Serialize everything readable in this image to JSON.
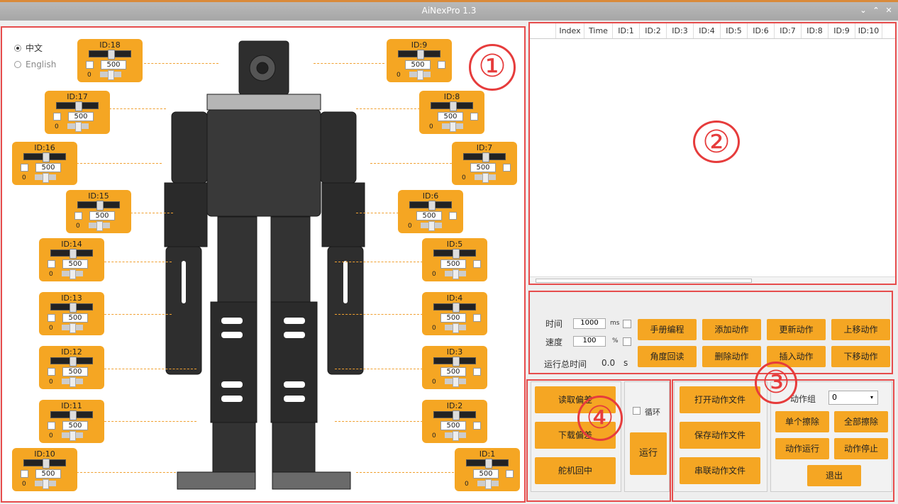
{
  "window": {
    "title": "AiNexPro 1.3"
  },
  "language": {
    "options": [
      "中文",
      "English"
    ],
    "selected": "中文"
  },
  "servos": [
    {
      "id": "ID:18",
      "value": "500",
      "min": "0"
    },
    {
      "id": "ID:17",
      "value": "500",
      "min": "0"
    },
    {
      "id": "ID:16",
      "value": "500",
      "min": "0"
    },
    {
      "id": "ID:15",
      "value": "500",
      "min": "0"
    },
    {
      "id": "ID:14",
      "value": "500",
      "min": "0"
    },
    {
      "id": "ID:13",
      "value": "500",
      "min": "0"
    },
    {
      "id": "ID:12",
      "value": "500",
      "min": "0"
    },
    {
      "id": "ID:11",
      "value": "500",
      "min": "0"
    },
    {
      "id": "ID:10",
      "value": "500",
      "min": "0"
    },
    {
      "id": "ID:9",
      "value": "500",
      "min": "0"
    },
    {
      "id": "ID:8",
      "value": "500",
      "min": "0"
    },
    {
      "id": "ID:7",
      "value": "500",
      "min": "0"
    },
    {
      "id": "ID:6",
      "value": "500",
      "min": "0"
    },
    {
      "id": "ID:5",
      "value": "500",
      "min": "0"
    },
    {
      "id": "ID:4",
      "value": "500",
      "min": "0"
    },
    {
      "id": "ID:3",
      "value": "500",
      "min": "0"
    },
    {
      "id": "ID:2",
      "value": "500",
      "min": "0"
    },
    {
      "id": "ID:1",
      "value": "500",
      "min": "0"
    }
  ],
  "table": {
    "columns": [
      "Index",
      "Time",
      "ID:1",
      "ID:2",
      "ID:3",
      "ID:4",
      "ID:5",
      "ID:6",
      "ID:7",
      "ID:8",
      "ID:9",
      "ID:10"
    ]
  },
  "annotations": [
    "①",
    "②",
    "③",
    "④"
  ],
  "controls": {
    "time_label": "时间",
    "time_value": "1000",
    "time_unit": "ms",
    "speed_label": "速度",
    "speed_value": "100",
    "speed_unit": "%",
    "total_label": "运行总时间",
    "total_value": "0.0",
    "total_unit": "s",
    "buttons": [
      "手册编程",
      "添加动作",
      "更新动作",
      "上移动作",
      "角度回读",
      "删除动作",
      "插入动作",
      "下移动作"
    ]
  },
  "deviation": {
    "read": "读取偏差",
    "download": "下载偏差",
    "center": "舵机回中"
  },
  "run": {
    "loop_label": "循环",
    "run_button": "运行"
  },
  "file": {
    "open": "打开动作文件",
    "save": "保存动作文件",
    "chain": "串联动作文件"
  },
  "group": {
    "label": "动作组",
    "selected": "0",
    "erase_one": "单个擦除",
    "erase_all": "全部擦除",
    "run": "动作运行",
    "stop": "动作停止",
    "exit": "退出"
  },
  "colors": {
    "accent": "#f5a623",
    "annotation": "#e63c3c"
  }
}
